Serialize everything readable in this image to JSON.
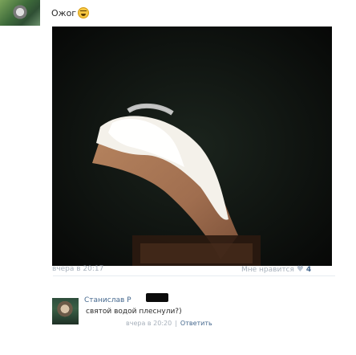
{
  "post": {
    "text": "Ожог",
    "time": "вчера в 20:17",
    "likes": {
      "label": "Мне нравится",
      "count": "4"
    }
  },
  "comment": {
    "author": "Станислав Р",
    "text": "святой водой плеснули?)",
    "time": "вчера в 20:20",
    "separator": "|",
    "reply_label": "Ответить"
  },
  "icons": {
    "emoji": "sad-face-emoji-icon",
    "heart": "heart-icon"
  },
  "colors": {
    "link": "#45688e",
    "muted": "#a7b0bb"
  }
}
